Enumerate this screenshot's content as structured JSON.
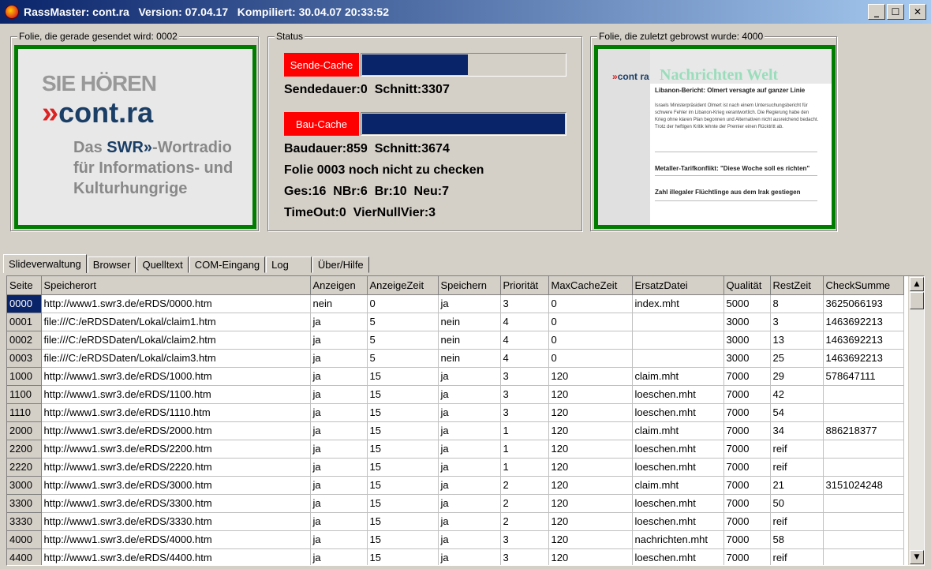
{
  "window": {
    "title": "RassMaster: cont.ra   Version: 07.04.17   Kompiliert: 30.04.07 20:33:52",
    "minimize": "_",
    "maximize": "☐",
    "close": "✕"
  },
  "left_group": {
    "legend": "Folie, die gerade gesendet wird: 0002",
    "preview": {
      "line1": "SIE HÖREN",
      "chevrons": "»",
      "brand": "cont.ra",
      "sub1_pre": "Das ",
      "sub1_swr": "SWR»",
      "sub1_post": "-Wortradio",
      "sub2": "für Informations- und",
      "sub3": "Kulturhungrige"
    }
  },
  "status_group": {
    "legend": "Status",
    "send_cache_label": "Sende-Cache",
    "send_cache_fill": 0.52,
    "send_line": "Sendedauer:0  Schnitt:3307",
    "build_cache_label": "Bau-Cache",
    "build_cache_fill": 1.0,
    "build_line": "Baudauer:859  Schnitt:3674",
    "check_line": "Folie 0003 noch nicht zu checken",
    "counts_line": "Ges:16  NBr:6  Br:10  Neu:7",
    "timeout_line": "TimeOut:0  VierNullVier:3"
  },
  "right_group": {
    "legend": "Folie, die zuletzt gebrowst wurde: 4000",
    "preview": {
      "logo_chev": "»",
      "logo": "cont ra",
      "title": "Nachrichten Welt",
      "headline1": "Libanon-Bericht: Olmert versagte auf ganzer Linie",
      "body1": "Israels Ministerpräsident Olmert ist nach einem Untersuchungsbericht für schwere Fehler im Libanon-Krieg verantwortlich. Die Regierung habe den Krieg ohne klaren Plan begonnen und Alternativen nicht ausreichend bedacht. Trotz der heftigen Kritik lehnte der Premier einen Rücktritt ab.",
      "headline2": "Metaller-Tarifkonflikt: \"Diese Woche soll es richten\"",
      "headline3": "Zahl illegaler Flüchtlinge aus dem Irak gestiegen"
    }
  },
  "tabs": [
    {
      "label": "Slideverwaltung",
      "active": true
    },
    {
      "label": "Browser",
      "active": false
    },
    {
      "label": "Quelltext",
      "active": false
    },
    {
      "label": "COM-Eingang",
      "active": false
    },
    {
      "label": "Log",
      "active": false
    },
    {
      "label": "Über/Hilfe",
      "active": false
    }
  ],
  "grid": {
    "columns": [
      "Seite",
      "Speicherort",
      "Anzeigen",
      "AnzeigeZeit",
      "Speichern",
      "Priorität",
      "MaxCacheZeit",
      "ErsatzDatei",
      "Qualität",
      "RestZeit",
      "CheckSumme"
    ],
    "rows": [
      [
        "0000",
        "http://www1.swr3.de/eRDS/0000.htm",
        "nein",
        "0",
        "ja",
        "3",
        "0",
        "index.mht",
        "5000",
        "8",
        "3625066193"
      ],
      [
        "0001",
        "file:///C:/eRDSDaten/Lokal/claim1.htm",
        "ja",
        "5",
        "nein",
        "4",
        "0",
        "",
        "3000",
        "3",
        "1463692213"
      ],
      [
        "0002",
        "file:///C:/eRDSDaten/Lokal/claim2.htm",
        "ja",
        "5",
        "nein",
        "4",
        "0",
        "",
        "3000",
        "13",
        "1463692213"
      ],
      [
        "0003",
        "file:///C:/eRDSDaten/Lokal/claim3.htm",
        "ja",
        "5",
        "nein",
        "4",
        "0",
        "",
        "3000",
        "25",
        "1463692213"
      ],
      [
        "1000",
        "http://www1.swr3.de/eRDS/1000.htm",
        "ja",
        "15",
        "ja",
        "3",
        "120",
        "claim.mht",
        "7000",
        "29",
        "578647111"
      ],
      [
        "1100",
        "http://www1.swr3.de/eRDS/1100.htm",
        "ja",
        "15",
        "ja",
        "3",
        "120",
        "loeschen.mht",
        "7000",
        "42",
        ""
      ],
      [
        "1110",
        "http://www1.swr3.de/eRDS/1110.htm",
        "ja",
        "15",
        "ja",
        "3",
        "120",
        "loeschen.mht",
        "7000",
        "54",
        ""
      ],
      [
        "2000",
        "http://www1.swr3.de/eRDS/2000.htm",
        "ja",
        "15",
        "ja",
        "1",
        "120",
        "claim.mht",
        "7000",
        "34",
        "886218377"
      ],
      [
        "2200",
        "http://www1.swr3.de/eRDS/2200.htm",
        "ja",
        "15",
        "ja",
        "1",
        "120",
        "loeschen.mht",
        "7000",
        "reif",
        ""
      ],
      [
        "2220",
        "http://www1.swr3.de/eRDS/2220.htm",
        "ja",
        "15",
        "ja",
        "1",
        "120",
        "loeschen.mht",
        "7000",
        "reif",
        ""
      ],
      [
        "3000",
        "http://www1.swr3.de/eRDS/3000.htm",
        "ja",
        "15",
        "ja",
        "2",
        "120",
        "claim.mht",
        "7000",
        "21",
        "3151024248"
      ],
      [
        "3300",
        "http://www1.swr3.de/eRDS/3300.htm",
        "ja",
        "15",
        "ja",
        "2",
        "120",
        "loeschen.mht",
        "7000",
        "50",
        ""
      ],
      [
        "3330",
        "http://www1.swr3.de/eRDS/3330.htm",
        "ja",
        "15",
        "ja",
        "2",
        "120",
        "loeschen.mht",
        "7000",
        "reif",
        ""
      ],
      [
        "4000",
        "http://www1.swr3.de/eRDS/4000.htm",
        "ja",
        "15",
        "ja",
        "3",
        "120",
        "nachrichten.mht",
        "7000",
        "58",
        ""
      ],
      [
        "4400",
        "http://www1.swr3.de/eRDS/4400.htm",
        "ja",
        "15",
        "ja",
        "3",
        "120",
        "loeschen.mht",
        "7000",
        "reif",
        ""
      ]
    ],
    "selected_row": 0
  },
  "colors": {
    "title_gradient_start": "#0a246a",
    "frame_green": "#007d00",
    "cache_label_red": "#ff0000",
    "progress_blue": "#0a246a"
  }
}
